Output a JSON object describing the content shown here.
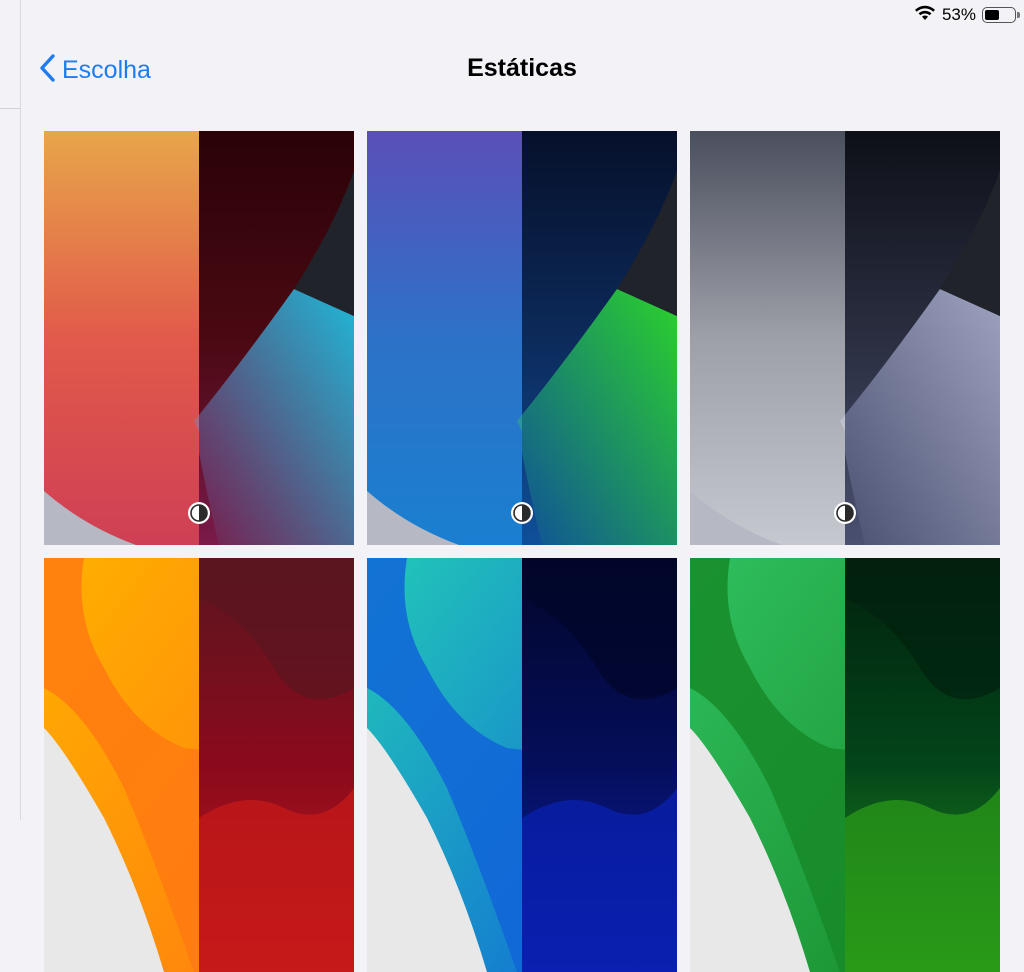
{
  "status_bar": {
    "battery_percent": "53%",
    "wifi_icon": "wifi-icon",
    "battery_icon": "battery-icon"
  },
  "nav": {
    "back_label": "Escolha",
    "title": "Estáticas"
  },
  "wallpapers": [
    {
      "id": "orange-red",
      "has_appearance_toggle": true,
      "light": [
        "#e8a64a",
        "#e15a4a",
        "#cf3f55"
      ],
      "dark": [
        "#2a0208",
        "#4a0912",
        "#7a1a4a"
      ],
      "accent_light": "#5cc4e0",
      "accent_dark": "#1fb8d8"
    },
    {
      "id": "purple-green",
      "has_appearance_toggle": true,
      "light": [
        "#5b4fb8",
        "#2d72c8",
        "#1a7fd0"
      ],
      "dark": [
        "#06102a",
        "#0c2a5a",
        "#0f4f9a"
      ],
      "accent_light": "#4ec93a",
      "accent_dark": "#2bd22b"
    },
    {
      "id": "gray",
      "has_appearance_toggle": true,
      "light": [
        "#4a4f5e",
        "#9ea0a8",
        "#c6c8d0"
      ],
      "dark": [
        "#0e1018",
        "#2a2e40",
        "#4a5070"
      ],
      "accent_light": "#b6bacb",
      "accent_dark": "#9da3bf"
    },
    {
      "id": "orange-yellow",
      "has_appearance_toggle": false,
      "light": [
        "#ffb000",
        "#ff7a10",
        "#e8e8e8"
      ],
      "dark": [
        "#5a1620",
        "#8a0a1c",
        "#c51a1a"
      ]
    },
    {
      "id": "blue-cyan",
      "has_appearance_toggle": false,
      "light": [
        "#22c8b8",
        "#1064d8",
        "#e8e8e8"
      ],
      "dark": [
        "#02062a",
        "#050e5a",
        "#0a20b0"
      ]
    },
    {
      "id": "green-lime",
      "has_appearance_toggle": false,
      "light": [
        "#2fbf5f",
        "#188a28",
        "#e8e8e8"
      ],
      "dark": [
        "#01210e",
        "#03451a",
        "#2a9a18"
      ]
    }
  ]
}
